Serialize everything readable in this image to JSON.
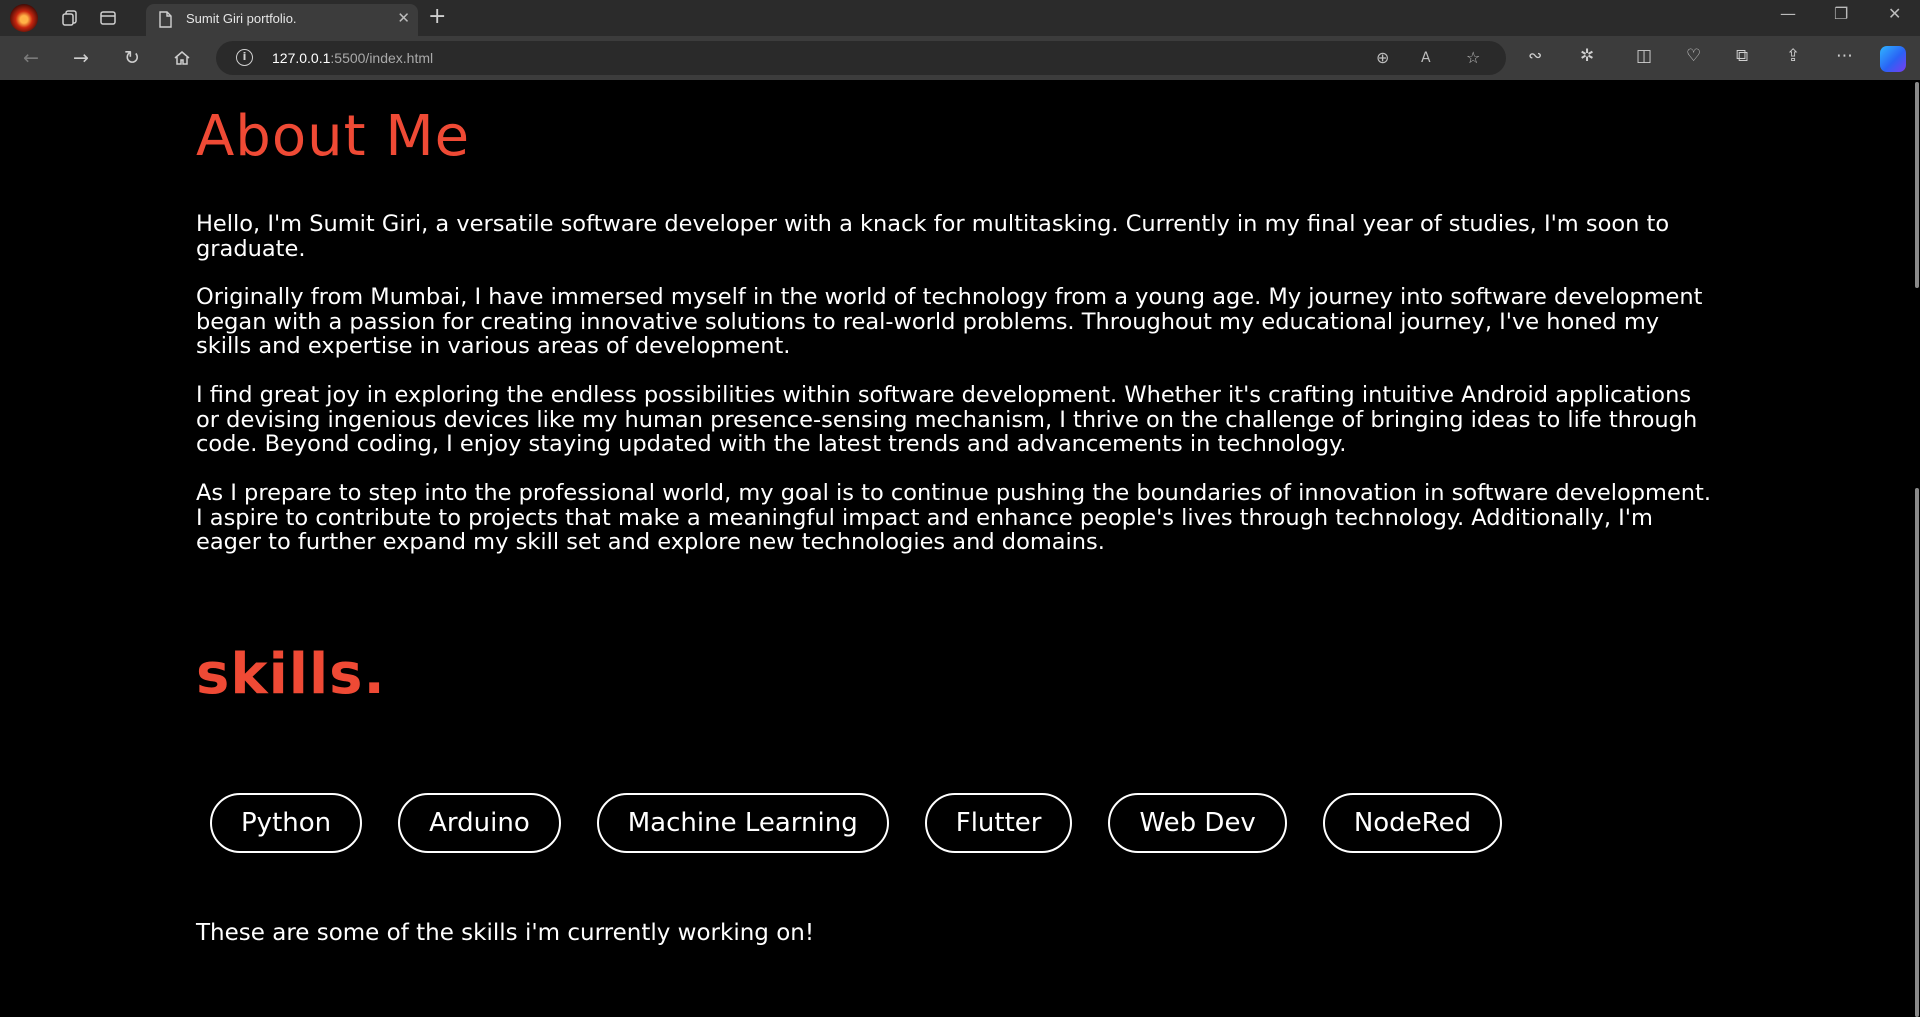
{
  "browser": {
    "tab_title": "Sumit Giri portfolio.",
    "tab_close": "✕",
    "new_tab": "+",
    "url_host": "127.0.0.1",
    "url_path": ":5500/index.html",
    "window_controls": {
      "minimize": "—",
      "restore": "❐",
      "close": "✕"
    }
  },
  "about": {
    "heading": "About Me",
    "paragraphs": [
      "Hello, I'm Sumit Giri, a versatile software developer with a knack for multitasking. Currently in my final year of studies, I'm soon to graduate.",
      "Originally from Mumbai, I have immersed myself in the world of technology from a young age. My journey into software development began with a passion for creating innovative solutions to real-world problems. Throughout my educational journey, I've honed my skills and expertise in various areas of development.",
      "I find great joy in exploring the endless possibilities within software development. Whether it's crafting intuitive Android applications or devising ingenious devices like my human presence-sensing mechanism, I thrive on the challenge of bringing ideas to life through code. Beyond coding, I enjoy staying updated with the latest trends and advancements in technology.",
      "As I prepare to step into the professional world, my goal is to continue pushing the boundaries of innovation in software development. I aspire to contribute to projects that make a meaningful impact and enhance people's lives through technology. Additionally, I'm eager to further expand my skill set and explore new technologies and domains."
    ]
  },
  "skills": {
    "heading": "skills.",
    "items": [
      "Python",
      "Arduino",
      "Machine Learning",
      "Flutter",
      "Web Dev",
      "NodeRed"
    ],
    "note": "These are some of the skills i'm currently working on!"
  },
  "colors": {
    "accent": "#ef4a35",
    "page_background": "#000000",
    "text": "#ffffff"
  }
}
